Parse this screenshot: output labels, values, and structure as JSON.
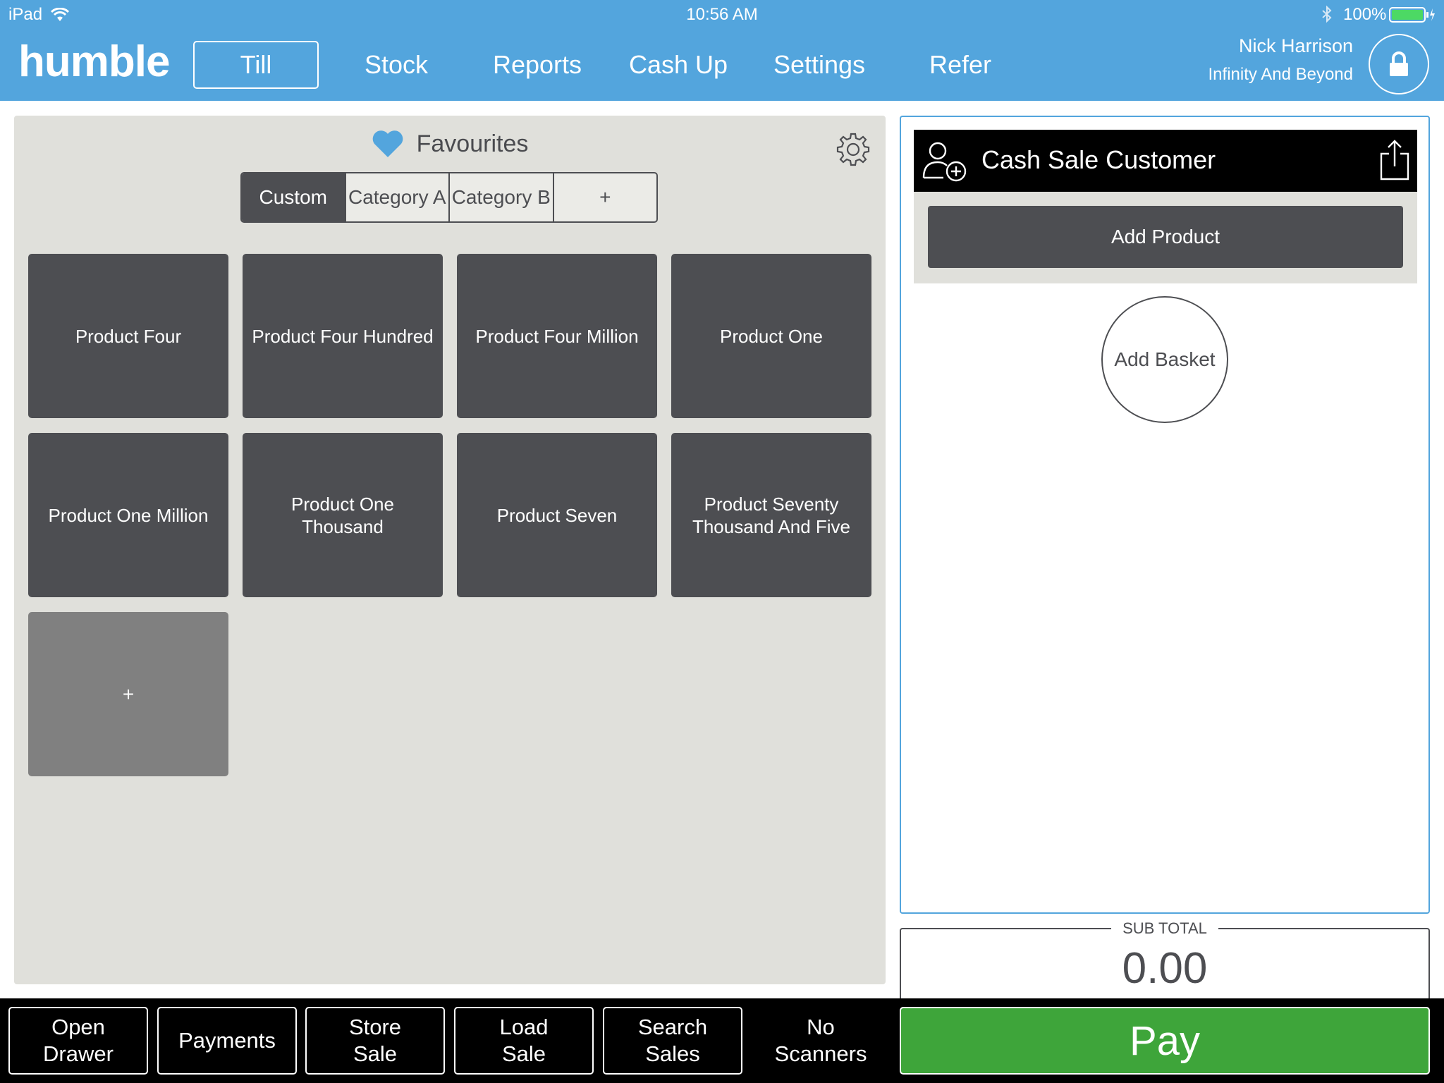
{
  "statusbar": {
    "device": "iPad",
    "time": "10:56 AM",
    "battery": "100%"
  },
  "brand": "humble",
  "nav": {
    "tabs": [
      "Till",
      "Stock",
      "Reports",
      "Cash Up",
      "Settings",
      "Refer"
    ],
    "active": "Till"
  },
  "user": {
    "name": "Nick Harrison",
    "org": "Infinity And Beyond"
  },
  "favourites": {
    "title": "Favourites",
    "categories": [
      "Custom",
      "Category A",
      "Category B",
      "+"
    ],
    "active_category": "Custom",
    "products": [
      "Product Four",
      "Product Four Hundred",
      "Product Four Million",
      "Product One",
      "Product One Million",
      "Product One Thousand",
      "Product Seven",
      "Product Seventy Thousand And Five"
    ],
    "add_tile": "+"
  },
  "basket": {
    "customer": "Cash Sale Customer",
    "add_product": "Add Product",
    "add_basket": "Add Basket"
  },
  "subtotal": {
    "label": "SUB TOTAL",
    "value": "0.00"
  },
  "toolbar": {
    "open_drawer": [
      "Open",
      "Drawer"
    ],
    "payments": "Payments",
    "store_sale": [
      "Store",
      "Sale"
    ],
    "load_sale": [
      "Load",
      "Sale"
    ],
    "search_sales": [
      "Search",
      "Sales"
    ],
    "no_scanners": [
      "No",
      "Scanners"
    ],
    "pay": "Pay"
  },
  "colors": {
    "header": "#53a5dd",
    "tile": "#4d4e52",
    "panel": "#e0e0db",
    "pay": "#3ea53a",
    "heart": "#53a5dd"
  },
  "icons": [
    "wifi-icon",
    "bluetooth-icon",
    "battery-icon",
    "lock-icon",
    "heart-icon",
    "gear-icon",
    "add-customer-icon",
    "share-icon"
  ]
}
